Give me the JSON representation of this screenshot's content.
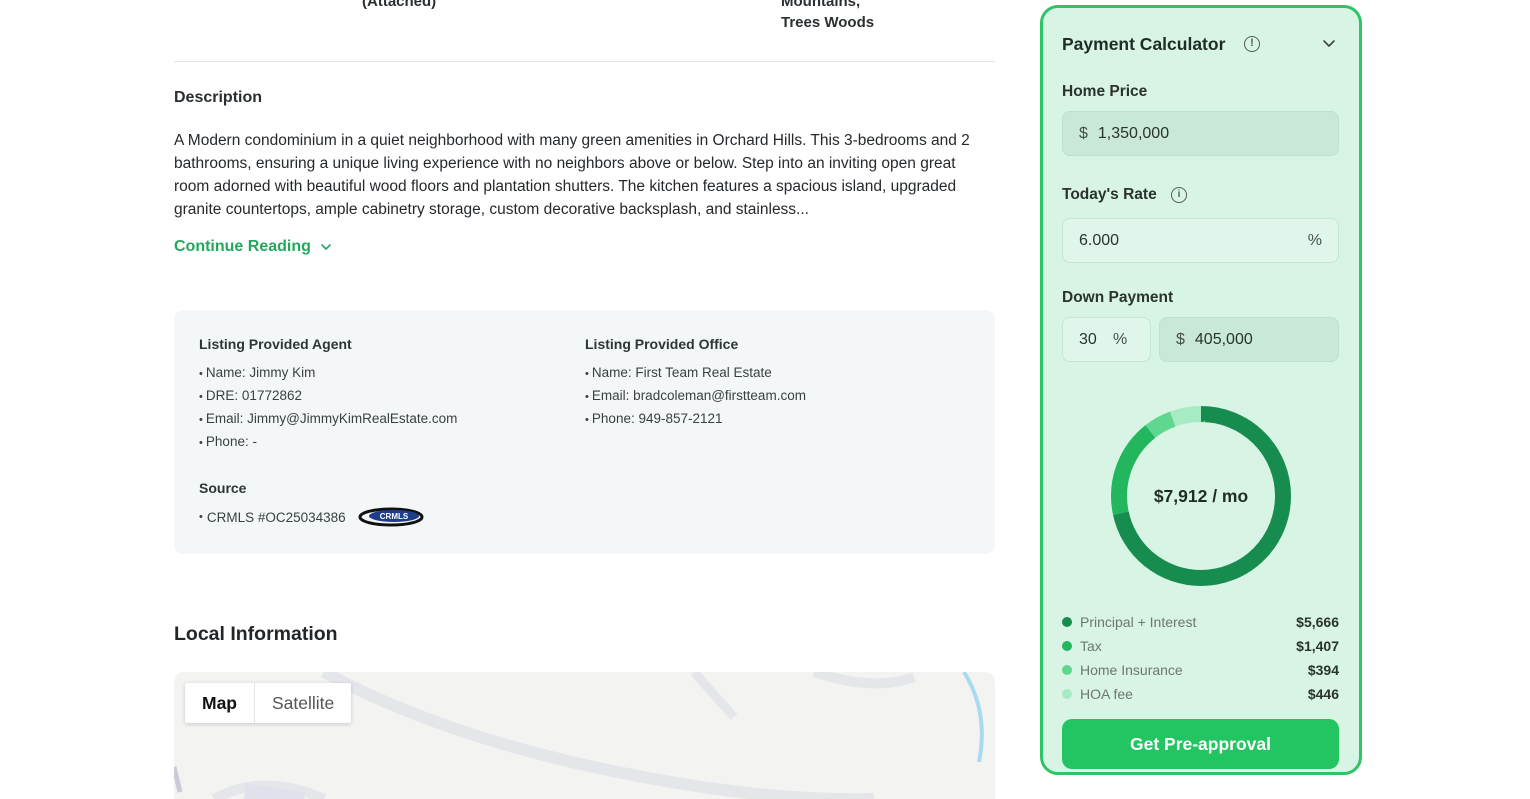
{
  "details": {
    "attached_text": "(Attached)",
    "view_line1": "Mountains,",
    "view_line2": "Trees Woods"
  },
  "description": {
    "heading": "Description",
    "text": "A Modern condominium in a quiet neighborhood with many green amenities in Orchard Hills. This 3-bedrooms and 2 bathrooms, ensuring a unique living experience with no neighbors above or below. Step into an inviting open great room adorned with beautiful wood floors and plantation shutters. The kitchen features a spacious island, upgraded granite countertops, ample cabinetry storage, custom decorative backsplash, and stainless...",
    "continue_label": "Continue Reading"
  },
  "listing": {
    "agent_heading": "Listing Provided Agent",
    "agent": [
      "Name: Jimmy Kim",
      "DRE: 01772862",
      "Email: Jimmy@JimmyKimRealEstate.com",
      "Phone: -"
    ],
    "office_heading": "Listing Provided Office",
    "office": [
      "Name: First Team Real Estate",
      "Email: bradcoleman@firstteam.com",
      "Phone: 949-857-2121"
    ],
    "source_heading": "Source",
    "source_text": "CRMLS #OC25034386",
    "source_logo_text": "CRMLS"
  },
  "local": {
    "heading": "Local Information",
    "map_label": "Map",
    "satellite_label": "Satellite"
  },
  "calculator": {
    "title": "Payment Calculator",
    "home_price_label": "Home Price",
    "home_price_prefix": "$",
    "home_price_value": "1,350,000",
    "rate_label": "Today's Rate",
    "rate_value": "6.000",
    "rate_suffix": "%",
    "down_label": "Down Payment",
    "down_percent": "30",
    "down_percent_suffix": "%",
    "down_amount_prefix": "$",
    "down_amount": "405,000",
    "monthly_total": "$7,912 / mo",
    "breakdown": [
      {
        "label": "Principal + Interest",
        "amount": "$5,666",
        "value": 5666,
        "color": "#178c4f"
      },
      {
        "label": "Tax",
        "amount": "$1,407",
        "value": 1407,
        "color": "#22b75f"
      },
      {
        "label": "Home Insurance",
        "amount": "$394",
        "value": 394,
        "color": "#5fd78e"
      },
      {
        "label": "HOA fee",
        "amount": "$446",
        "value": 446,
        "color": "#a6ebc3"
      }
    ],
    "cta_label": "Get Pre-approval"
  },
  "colors": {
    "accent_green": "#22c562",
    "link_green": "#23a85d"
  }
}
